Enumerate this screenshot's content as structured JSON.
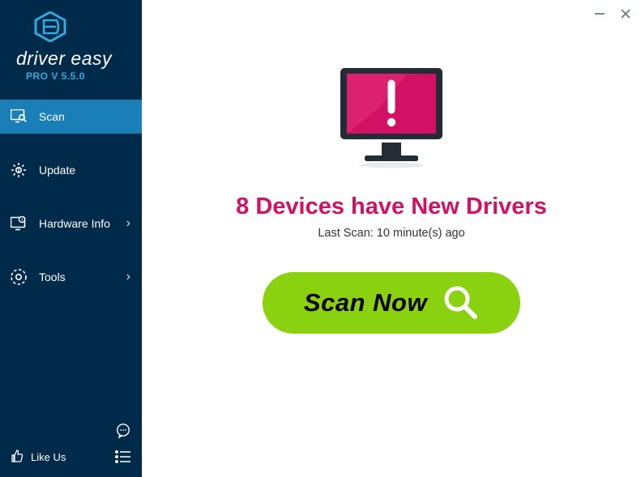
{
  "brand": {
    "name": "driver easy",
    "version": "PRO V 5.5.0"
  },
  "nav": {
    "scan": "Scan",
    "update": "Update",
    "hardware": "Hardware Info",
    "tools": "Tools"
  },
  "footer": {
    "like": "Like Us"
  },
  "main": {
    "headline": "8 Devices have New Drivers",
    "last_scan": "Last Scan: 10 minute(s) ago",
    "scan_button": "Scan Now"
  },
  "colors": {
    "accent_pink": "#d31164",
    "scan_green": "#8ad20f",
    "sidebar": "#002a4a",
    "active": "#1b7fb7"
  }
}
